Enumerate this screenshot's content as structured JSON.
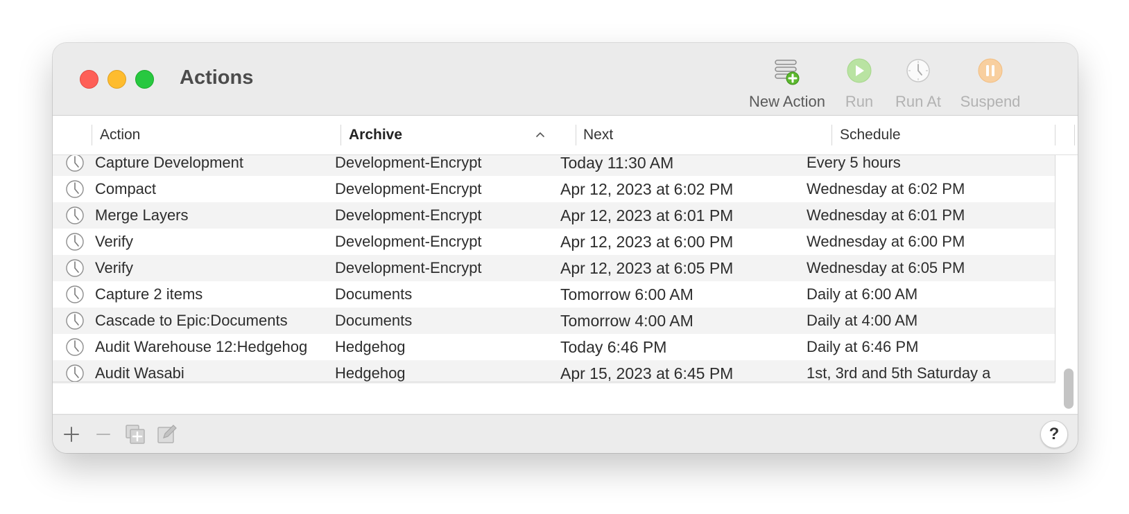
{
  "window": {
    "title": "Actions"
  },
  "toolbar": {
    "new_action": "New Action",
    "run": "Run",
    "run_at": "Run At",
    "suspend": "Suspend"
  },
  "columns": {
    "action": "Action",
    "archive": "Archive",
    "next": "Next",
    "schedule": "Schedule",
    "sorted_by": "Archive",
    "sort_direction": "ascending"
  },
  "rows": [
    {
      "action": "Capture Development",
      "archive": "Development-Encrypt",
      "next": "Today 11:30 AM",
      "schedule": "Every 5 hours"
    },
    {
      "action": "Compact",
      "archive": "Development-Encrypt",
      "next": "Apr 12, 2023 at 6:02 PM",
      "schedule": "Wednesday at 6:02 PM"
    },
    {
      "action": "Merge Layers",
      "archive": "Development-Encrypt",
      "next": "Apr 12, 2023 at 6:01 PM",
      "schedule": "Wednesday at 6:01 PM"
    },
    {
      "action": "Verify",
      "archive": "Development-Encrypt",
      "next": "Apr 12, 2023 at 6:00 PM",
      "schedule": "Wednesday at 6:00 PM"
    },
    {
      "action": "Verify",
      "archive": "Development-Encrypt",
      "next": "Apr 12, 2023 at 6:05 PM",
      "schedule": "Wednesday at 6:05 PM"
    },
    {
      "action": "Capture 2 items",
      "archive": "Documents",
      "next": "Tomorrow 6:00 AM",
      "schedule": "Daily at 6:00 AM"
    },
    {
      "action": "Cascade to Epic:Documents",
      "archive": "Documents",
      "next": "Tomorrow 4:00 AM",
      "schedule": "Daily at 4:00 AM"
    },
    {
      "action": "Audit Warehouse 12:Hedgehog",
      "archive": "Hedgehog",
      "next": "Today 6:46 PM",
      "schedule": "Daily at 6:46 PM"
    },
    {
      "action": "Audit Wasabi",
      "archive": "Hedgehog",
      "next": "Apr 15, 2023 at 6:45 PM",
      "schedule": "1st, 3rd and 5th Saturday a"
    }
  ],
  "footer": {
    "help_label": "?"
  },
  "icons": {
    "row_icon": "clock-icon",
    "add": "plus-icon",
    "remove": "minus-icon",
    "duplicate": "duplicate-icon",
    "edit": "edit-icon",
    "new_action": "stack-plus-icon",
    "run": "play-icon",
    "run_at": "clock-icon",
    "suspend": "pause-icon"
  },
  "colors": {
    "close": "#fe5f57",
    "minimize": "#febc2e",
    "zoom": "#28c840",
    "run_green": "#7ccf4e",
    "suspend_orange": "#f4a340",
    "add_badge": "#5cb82e"
  }
}
